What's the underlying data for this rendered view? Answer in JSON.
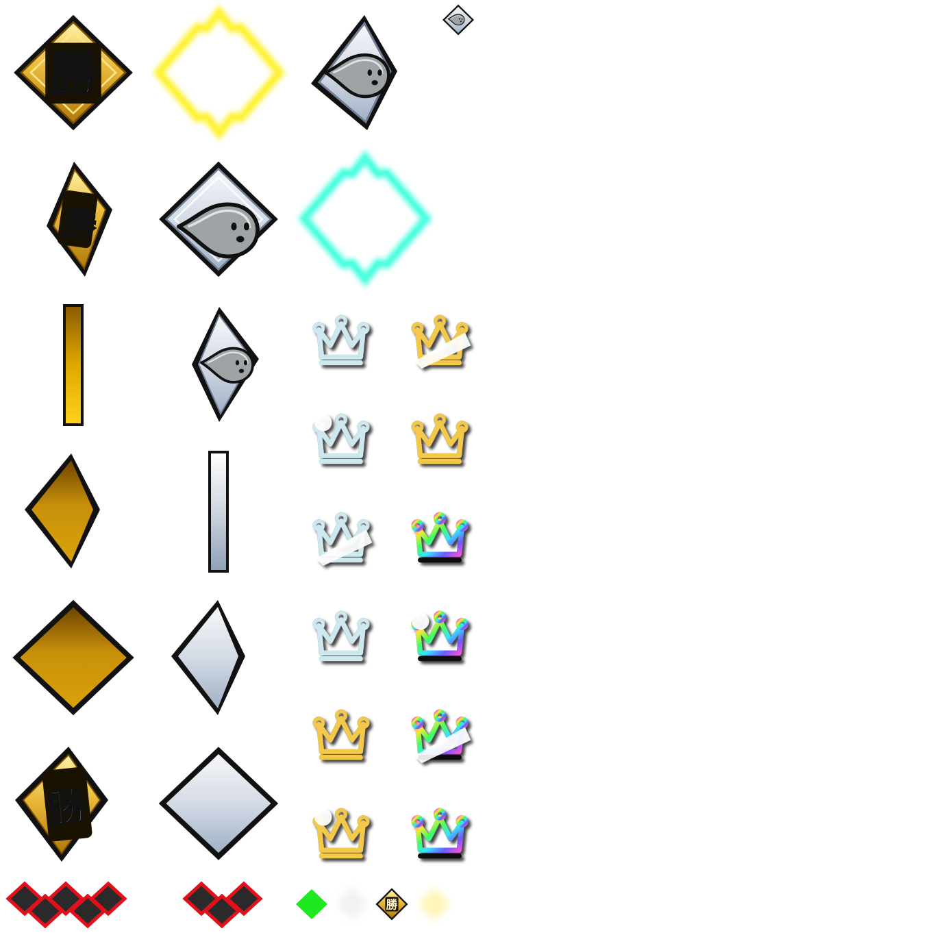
{
  "sprite_sheet": {
    "badges": {
      "win_kanji": "勝",
      "win_kanji_small": "勝"
    },
    "icons": [
      "win-badge-large-icon",
      "yellow-glow-frame-icon",
      "ghost-badge-skewed-icon",
      "ghost-badge-mini-icon",
      "win-badge-skewed-icon",
      "ghost-badge-large-icon",
      "cyan-glow-frame-icon",
      "gold-bar-icon",
      "ghost-badge-narrow-icon",
      "gold-diamond-narrow-icon",
      "silver-bar-icon",
      "gold-diamond-wide-icon",
      "silver-diamond-narrow-icon",
      "win-badge-perspective-icon",
      "silver-diamond-wide-icon",
      "crown-icon",
      "life-stock-icon",
      "green-diamond-icon",
      "white-glow-diamond-icon",
      "win-badge-mini-icon",
      "cream-glow-diamond-icon"
    ],
    "crowns": {
      "silver": "crown-silver",
      "gold": "crown-gold",
      "rainbow": "crown-rainbow"
    },
    "colors": {
      "gold_light": "#f7d35a",
      "gold_dark": "#8a5a00",
      "silver_light": "#eef1f6",
      "silver_dark": "#8ea1b8",
      "yellow_glow": "#fff23a",
      "cyan_glow": "#4fffe0",
      "outline": "#111111",
      "life_red": "#e2101a",
      "life_dark": "#2a2a2a",
      "green": "#1ee81e"
    }
  }
}
